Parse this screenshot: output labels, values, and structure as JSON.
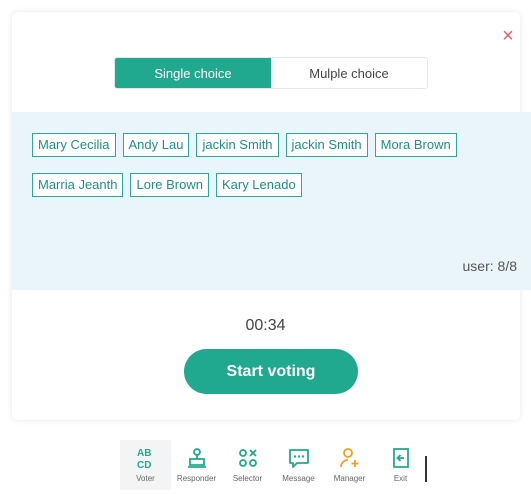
{
  "dialog": {
    "close_glyph": "×",
    "tabs": [
      {
        "label": "Single choice",
        "active": true
      },
      {
        "label": "Mulple choice",
        "active": false
      }
    ],
    "participants": [
      "Mary Cecilia",
      "Andy Lau",
      "jackin Smith",
      "jackin Smith",
      "Mora Brown",
      "Marria Jeanth",
      "Lore Brown",
      "Kary Lenado"
    ],
    "user_count": "user: 8/8",
    "timer": "00:34",
    "start_label": "Start voting"
  },
  "toolbar": {
    "items": [
      {
        "label": "Voter",
        "icon": "voter-icon",
        "active": true
      },
      {
        "label": "Responder",
        "icon": "responder-icon",
        "active": false
      },
      {
        "label": "Selector",
        "icon": "selector-icon",
        "active": false
      },
      {
        "label": "Message",
        "icon": "message-icon",
        "active": false
      },
      {
        "label": "Manager",
        "icon": "manager-icon",
        "active": false
      },
      {
        "label": "Exit",
        "icon": "exit-icon",
        "active": false
      }
    ]
  },
  "colors": {
    "accent": "#20a98f",
    "chip_border": "#2aa89a",
    "panel_bg": "#eaf4fb",
    "close": "#e0606a",
    "manager_icon": "#f0a020"
  }
}
